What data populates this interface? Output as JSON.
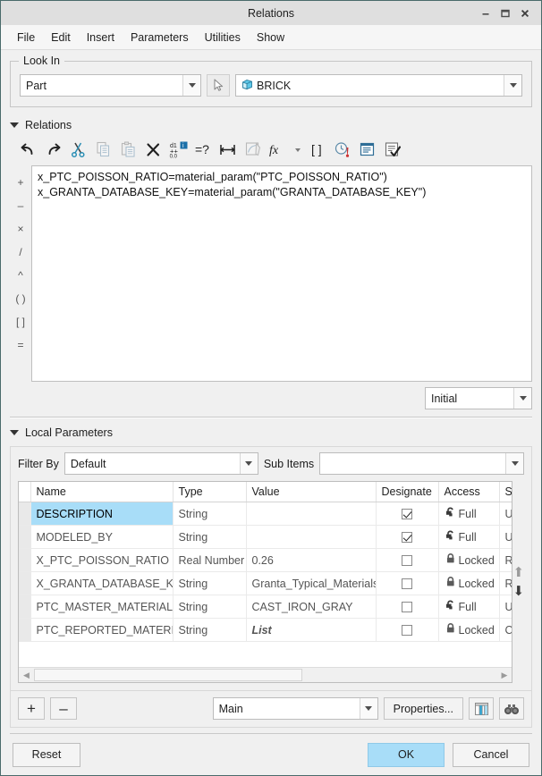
{
  "window": {
    "title": "Relations",
    "minimize_label": "Minimize",
    "maximize_label": "Maximize",
    "close_label": "Close"
  },
  "menubar": {
    "items": [
      {
        "label": "File"
      },
      {
        "label": "Edit"
      },
      {
        "label": "Insert"
      },
      {
        "label": "Parameters"
      },
      {
        "label": "Utilities"
      },
      {
        "label": "Show"
      }
    ]
  },
  "look_in": {
    "group_title": "Look In",
    "scope_value": "Part",
    "select_tool_title": "Select",
    "model_value": "BRICK"
  },
  "relations": {
    "section_title": "Relations",
    "toolbar": [
      {
        "name": "undo-icon",
        "title": "Undo"
      },
      {
        "name": "redo-icon",
        "title": "Redo"
      },
      {
        "name": "cut-icon",
        "title": "Cut"
      },
      {
        "name": "copy-icon",
        "title": "Copy"
      },
      {
        "name": "paste-icon",
        "title": "Paste"
      },
      {
        "name": "delete-icon",
        "title": "Delete"
      },
      {
        "name": "units-icon",
        "title": "Units"
      },
      {
        "name": "verify-icon",
        "title": "Verify"
      },
      {
        "name": "dimension-icon",
        "title": "Insert Dimension"
      },
      {
        "name": "sketch-icon",
        "title": "Sketch"
      },
      {
        "name": "function-icon",
        "title": "Insert Function"
      },
      {
        "name": "function-dropdown-arrow",
        "title": "Function List"
      },
      {
        "name": "brackets-icon",
        "title": "Brackets"
      },
      {
        "name": "history-icon",
        "title": "Relation History"
      },
      {
        "name": "list-icon",
        "title": "Parameter List"
      },
      {
        "name": "check-list-icon",
        "title": "Execute"
      }
    ],
    "operators": [
      "+",
      "–",
      "×",
      "/",
      "^",
      "( )",
      "[ ]",
      "="
    ],
    "text": "x_PTC_POISSON_RATIO=material_param(\"PTC_POISSON_RATIO\")\nx_GRANTA_DATABASE_KEY=material_param(\"GRANTA_DATABASE_KEY\")",
    "initial_value": "Initial"
  },
  "local_parameters": {
    "section_title": "Local Parameters",
    "filter_by_label": "Filter By",
    "filter_by_value": "Default",
    "sub_items_label": "Sub Items",
    "sub_items_value": "",
    "columns": [
      "Name",
      "Type",
      "Value",
      "Designate",
      "Access",
      "S"
    ],
    "rows": [
      {
        "name": "DESCRIPTION",
        "type": "String",
        "value": "",
        "value_style": "normal",
        "designate": true,
        "access": "Full",
        "access_icon": "lock-open-icon",
        "source": "Us",
        "selected": true
      },
      {
        "name": "MODELED_BY",
        "type": "String",
        "value": "",
        "value_style": "normal",
        "designate": true,
        "access": "Full",
        "access_icon": "lock-open-icon",
        "source": "Us",
        "selected": false
      },
      {
        "name": "X_PTC_POISSON_RATIO",
        "type": "Real Number",
        "value": "0.26",
        "value_style": "normal",
        "designate": false,
        "access": "Locked",
        "access_icon": "lock-closed-icon",
        "source": "Re",
        "selected": false
      },
      {
        "name": "X_GRANTA_DATABASE_KEY",
        "type": "String",
        "value": "Granta_Typical_Materials",
        "value_style": "normal",
        "designate": false,
        "access": "Locked",
        "access_icon": "lock-closed-icon",
        "source": "Re",
        "selected": false
      },
      {
        "name": "PTC_MASTER_MATERIAL",
        "type": "String",
        "value": "CAST_IRON_GRAY",
        "value_style": "strong",
        "designate": false,
        "access": "Full",
        "access_icon": "lock-open-icon",
        "source": "Us",
        "selected": false
      },
      {
        "name": "PTC_REPORTED_MATERIAL",
        "type": "String",
        "value": "List",
        "value_style": "list",
        "designate": false,
        "access": "Locked",
        "access_icon": "lock-closed-icon",
        "source": "Cr",
        "selected": false
      }
    ],
    "move_up_title": "Move Up",
    "move_down_title": "Move Down",
    "add_label": "+",
    "remove_label": "–",
    "scope_value": "Main",
    "properties_label": "Properties...",
    "columns_button_title": "Columns",
    "find_button_title": "Find"
  },
  "footer": {
    "reset_label": "Reset",
    "ok_label": "OK",
    "cancel_label": "Cancel"
  },
  "colors": {
    "selection": "#a8ddf8",
    "accent_blue": "#1b5e9e",
    "window_border": "#4a6b6b",
    "background": "#f0f0f0"
  }
}
